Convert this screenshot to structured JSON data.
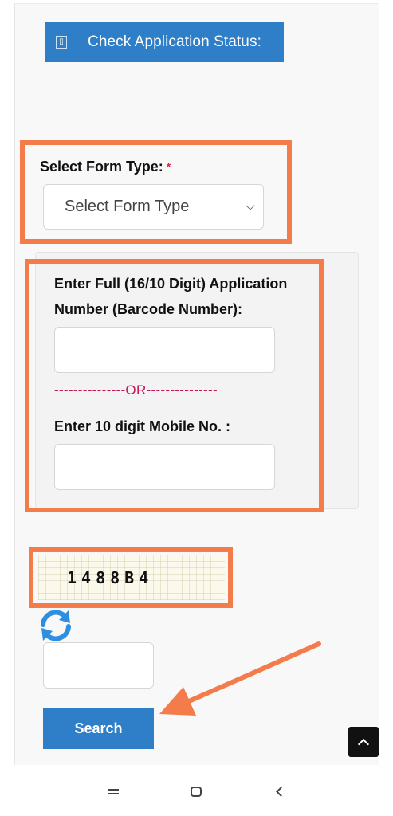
{
  "header": {
    "icon": "info-icon",
    "icon_glyph": "▯",
    "title": "Check Application Status:"
  },
  "form_type": {
    "label": "Select Form Type:",
    "required_mark": "*",
    "select_value": "Select Form Type"
  },
  "application": {
    "label_line1": "Enter Full (16/10 Digit) Application",
    "label_line2": "Number (Barcode Number):",
    "value": ""
  },
  "separator": "---------------OR---------------",
  "mobile": {
    "label": "Enter 10 digit Mobile No. :",
    "value": ""
  },
  "captcha": {
    "text": "1488B4",
    "input_value": ""
  },
  "search_label": "Search",
  "colors": {
    "accent": "#2e7ec8",
    "highlight": "#f47c4b",
    "required": "#d7263d",
    "separator": "#c2185b"
  }
}
